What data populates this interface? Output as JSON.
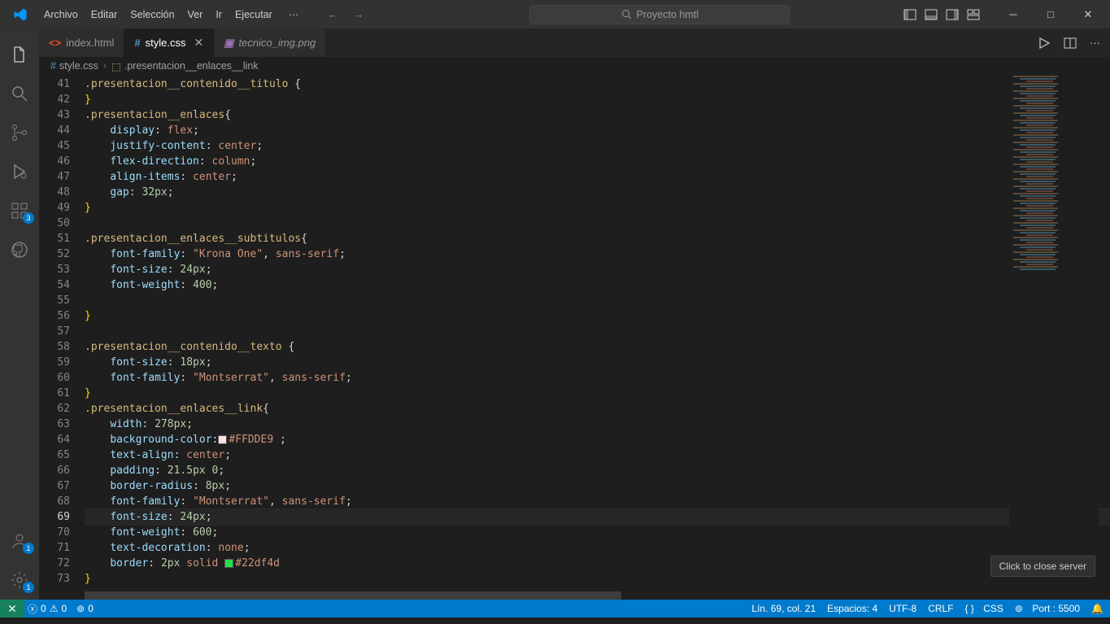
{
  "menu": [
    "Archivo",
    "Editar",
    "Selección",
    "Ver",
    "Ir",
    "Ejecutar"
  ],
  "search_placeholder": "Proyecto hmtl",
  "tabs": [
    {
      "label": "index.html",
      "icon": "html",
      "active": false
    },
    {
      "label": "style.css",
      "icon": "css",
      "active": true,
      "modified": true
    },
    {
      "label": "tecnico_img.png",
      "icon": "img",
      "active": false,
      "italic": true
    }
  ],
  "breadcrumbs": {
    "file": "style.css",
    "symbol": ".presentacion__enlaces__link"
  },
  "line_start": 41,
  "line_highlight": 69,
  "code_lines": [
    {
      "t": "sel",
      "raw": [
        [
          "sel",
          ".presentacion__contenido__titulo "
        ],
        [
          "pun",
          "{"
        ]
      ]
    },
    {
      "raw": [
        [
          "brace",
          "}"
        ]
      ]
    },
    {
      "raw": [
        [
          "sel",
          ".presentacion__enlaces"
        ],
        [
          "pun",
          "{"
        ]
      ]
    },
    {
      "indent": 2,
      "raw": [
        [
          "prop",
          "display"
        ],
        [
          "pun",
          ": "
        ],
        [
          "val",
          "flex"
        ],
        [
          "pun",
          ";"
        ]
      ]
    },
    {
      "indent": 2,
      "raw": [
        [
          "prop",
          "justify-content"
        ],
        [
          "pun",
          ": "
        ],
        [
          "val",
          "center"
        ],
        [
          "pun",
          ";"
        ]
      ]
    },
    {
      "indent": 2,
      "raw": [
        [
          "prop",
          "flex-direction"
        ],
        [
          "pun",
          ": "
        ],
        [
          "val",
          "column"
        ],
        [
          "pun",
          ";"
        ]
      ]
    },
    {
      "indent": 2,
      "raw": [
        [
          "prop",
          "align-items"
        ],
        [
          "pun",
          ": "
        ],
        [
          "val",
          "center"
        ],
        [
          "pun",
          ";"
        ]
      ]
    },
    {
      "indent": 2,
      "raw": [
        [
          "prop",
          "gap"
        ],
        [
          "pun",
          ": "
        ],
        [
          "num",
          "32px"
        ],
        [
          "pun",
          ";"
        ]
      ]
    },
    {
      "raw": [
        [
          "brace",
          "}"
        ]
      ]
    },
    {
      "raw": []
    },
    {
      "raw": [
        [
          "sel",
          ".presentacion__enlaces__subtitulos"
        ],
        [
          "pun",
          "{"
        ]
      ]
    },
    {
      "indent": 2,
      "raw": [
        [
          "prop",
          "font-family"
        ],
        [
          "pun",
          ": "
        ],
        [
          "str",
          "\"Krona One\""
        ],
        [
          "pun",
          ", "
        ],
        [
          "val",
          "sans-serif"
        ],
        [
          "pun",
          ";"
        ]
      ]
    },
    {
      "indent": 2,
      "raw": [
        [
          "prop",
          "font-size"
        ],
        [
          "pun",
          ": "
        ],
        [
          "num",
          "24px"
        ],
        [
          "pun",
          ";"
        ]
      ]
    },
    {
      "indent": 2,
      "raw": [
        [
          "prop",
          "font-weight"
        ],
        [
          "pun",
          ": "
        ],
        [
          "num",
          "400"
        ],
        [
          "pun",
          ";"
        ]
      ]
    },
    {
      "raw": []
    },
    {
      "raw": [
        [
          "brace",
          "}"
        ]
      ]
    },
    {
      "raw": []
    },
    {
      "raw": [
        [
          "sel",
          ".presentacion__contenido__texto "
        ],
        [
          "pun",
          "{"
        ]
      ]
    },
    {
      "indent": 2,
      "raw": [
        [
          "prop",
          "font-size"
        ],
        [
          "pun",
          ": "
        ],
        [
          "num",
          "18px"
        ],
        [
          "pun",
          ";"
        ]
      ]
    },
    {
      "indent": 2,
      "raw": [
        [
          "prop",
          "font-family"
        ],
        [
          "pun",
          ": "
        ],
        [
          "str",
          "\"Montserrat\""
        ],
        [
          "pun",
          ", "
        ],
        [
          "val",
          "sans-serif"
        ],
        [
          "pun",
          ";"
        ]
      ]
    },
    {
      "raw": [
        [
          "brace",
          "}"
        ]
      ]
    },
    {
      "raw": [
        [
          "sel",
          ".presentacion__enlaces__link"
        ],
        [
          "pun",
          "{"
        ]
      ]
    },
    {
      "indent": 2,
      "raw": [
        [
          "prop",
          "width"
        ],
        [
          "pun",
          ": "
        ],
        [
          "num",
          "278px"
        ],
        [
          "pun",
          ";"
        ]
      ]
    },
    {
      "indent": 2,
      "raw": [
        [
          "prop",
          "background-color"
        ],
        [
          "pun",
          ":"
        ],
        [
          "swatch",
          "#FFDDE9"
        ],
        [
          "val",
          "#FFDDE9 "
        ],
        [
          "pun",
          ";"
        ]
      ]
    },
    {
      "indent": 2,
      "raw": [
        [
          "prop",
          "text-align"
        ],
        [
          "pun",
          ": "
        ],
        [
          "val",
          "center"
        ],
        [
          "pun",
          ";"
        ]
      ]
    },
    {
      "indent": 2,
      "raw": [
        [
          "prop",
          "padding"
        ],
        [
          "pun",
          ": "
        ],
        [
          "num",
          "21.5px 0"
        ],
        [
          "pun",
          ";"
        ]
      ]
    },
    {
      "indent": 2,
      "raw": [
        [
          "prop",
          "border-radius"
        ],
        [
          "pun",
          ": "
        ],
        [
          "num",
          "8px"
        ],
        [
          "pun",
          ";"
        ]
      ]
    },
    {
      "indent": 2,
      "raw": [
        [
          "prop",
          "font-family"
        ],
        [
          "pun",
          ": "
        ],
        [
          "str",
          "\"Montserrat\""
        ],
        [
          "pun",
          ", "
        ],
        [
          "val",
          "sans-serif"
        ],
        [
          "pun",
          ";"
        ]
      ]
    },
    {
      "indent": 2,
      "raw": [
        [
          "prop",
          "font-size"
        ],
        [
          "pun",
          ": "
        ],
        [
          "num",
          "24px"
        ],
        [
          "pun",
          ";"
        ]
      ]
    },
    {
      "indent": 2,
      "raw": [
        [
          "prop",
          "font-weight"
        ],
        [
          "pun",
          ": "
        ],
        [
          "num",
          "600"
        ],
        [
          "pun",
          ";"
        ]
      ]
    },
    {
      "indent": 2,
      "raw": [
        [
          "prop",
          "text-decoration"
        ],
        [
          "pun",
          ": "
        ],
        [
          "val",
          "none"
        ],
        [
          "pun",
          ";"
        ]
      ]
    },
    {
      "indent": 2,
      "raw": [
        [
          "prop",
          "border"
        ],
        [
          "pun",
          ": "
        ],
        [
          "num",
          "2px "
        ],
        [
          "val",
          "solid "
        ],
        [
          "swatch",
          "#22df4d"
        ],
        [
          "val",
          "#22df4d"
        ]
      ]
    },
    {
      "raw": [
        [
          "brace",
          "}"
        ]
      ]
    }
  ],
  "activity_badges": {
    "extensions": "3",
    "account": "1",
    "settings": "1"
  },
  "status": {
    "errors": "0",
    "warnings": "0",
    "port_icon": "0",
    "cursor": "Lín. 69, col. 21",
    "spaces": "Espacios: 4",
    "enc": "UTF-8",
    "eol": "CRLF",
    "lang": "CSS",
    "port": "Port : 5500"
  },
  "tooltip": "Click to close server"
}
